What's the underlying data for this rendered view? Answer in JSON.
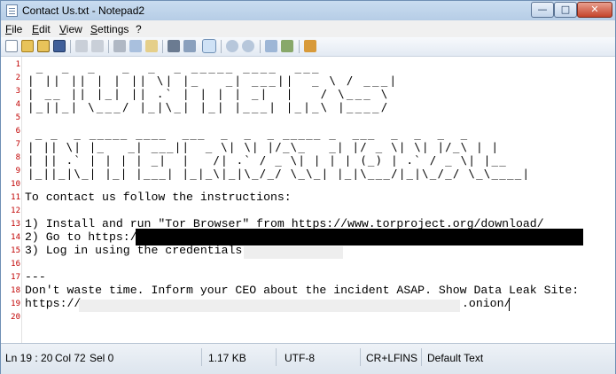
{
  "window": {
    "title": "Contact Us.txt - Notepad2",
    "buttons": {
      "minimize": "—",
      "maximize": "□",
      "close": "✕"
    }
  },
  "menu": [
    "File",
    "Edit",
    "View",
    "Settings",
    "?"
  ],
  "toolbar": {
    "icons": [
      "new-file-icon",
      "open-folder-icon",
      "browse-icon",
      "save-icon",
      "undo-icon",
      "redo-icon",
      "cut-icon",
      "copy-icon",
      "paste-icon",
      "find-icon",
      "replace-icon",
      "word-wrap-icon",
      "zoom-in-icon",
      "zoom-out-icon",
      "scheme-icon",
      "settings-icon",
      "exit-icon"
    ]
  },
  "editor": {
    "line_numbers": [
      "1",
      "2",
      "3",
      "4",
      "5",
      "6",
      "7",
      "8",
      "9",
      "10",
      "11",
      "12",
      "13",
      "14",
      "15",
      "16",
      "17",
      "18",
      "19",
      "20"
    ],
    "ascii_banner": [
      " _  _  _   _  _  _ _____ ____  ___  ",
      "| || || | | || \\| |_   _| ___||  _ \\ / ___|",
      "| __ || |_| || .` | | | | _|  |   / \\___ \\",
      "|_||_| \\___/ |_|\\_| |_| |___| |_|_\\ |____/",
      "",
      " _ _  _ _____ ____  ___  _  _  _ _____ _  ___  _  _  _  _",
      "| || \\| |_   _| ___||  _ \\| \\| |/_\\_   _| |/ _ \\| \\| |/_\\ | |",
      "| || .` | | | | _|  |   /| .` / _ \\| | | | (_) | .` / _ \\| |__",
      "|_||_|\\_| |_| |___| |_|_\\|_|\\_/_/ \\_\\_| |_|\\___/|_|\\_/_/ \\_\\____|"
    ],
    "line11": "To contact us follow the instructions:",
    "line13": "1) Install and run \"Tor Browser\" from https://www.torproject.org/download/",
    "line14": "2) Go to https://",
    "line15": "3) Log in using the credentials:",
    "line17": "---",
    "line18": "Don't waste time. Inform your CEO about the incident ASAP. Show Data Leak Site:",
    "line19_prefix": "https://",
    "line19_suffix": ".onion/"
  },
  "status": {
    "position": "Ln 19 : 20",
    "column": "Col 72",
    "selection": "Sel 0",
    "size": "1.17 KB",
    "encoding": "UTF-8",
    "line_ending": "CR+LF",
    "mode": "INS",
    "scheme": "Default Text"
  }
}
